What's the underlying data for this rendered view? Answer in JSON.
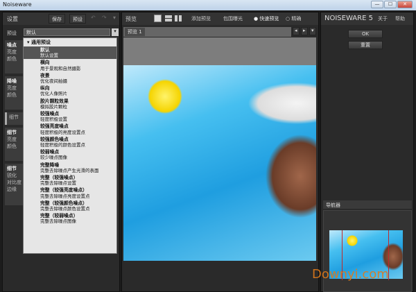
{
  "window": {
    "title": "Noiseware",
    "min": "—",
    "max": "☐",
    "close": "✕"
  },
  "left": {
    "title": "设置",
    "save": "保存",
    "preset": "预设",
    "undo": "↶",
    "redo": "↷",
    "menu": "▾",
    "preset_label": "预设",
    "preset_value": "默认",
    "sections": [
      {
        "title": "噪点",
        "items": [
          "亮度",
          "颜色"
        ]
      },
      {
        "title": "降噪",
        "items": [
          "亮度",
          "颜色"
        ]
      },
      {
        "title": "细节",
        "items": []
      },
      {
        "title": "细节",
        "items": [
          "亮度",
          "颜色"
        ]
      },
      {
        "title": "细节",
        "items": [
          "锐化",
          "对比度",
          "边缘"
        ]
      }
    ]
  },
  "dropdown": {
    "group": "通用预设",
    "items": [
      {
        "name": "默认",
        "desc": "默认设置",
        "selected": true
      },
      {
        "name": "横向",
        "desc": "用于景观和自然摄影"
      },
      {
        "name": "夜景",
        "desc": "优化夜间拍摄"
      },
      {
        "name": "纵向",
        "desc": "优化人像照片"
      },
      {
        "name": "胶片颗粒效果",
        "desc": "模拟胶片颗粒"
      },
      {
        "name": "较强噪点",
        "desc": "轻度积极设置"
      },
      {
        "name": "较强亮度噪点",
        "desc": "轻度积极的亮度设置点"
      },
      {
        "name": "较强颜色噪点",
        "desc": "轻度积极的颜色设置点"
      },
      {
        "name": "较弱噪点",
        "desc": "较少噪点图像"
      },
      {
        "name": "完整降噪",
        "desc": "完整去除噪点产生光滑的表面"
      },
      {
        "name": "完整（较强噪点）",
        "desc": "完整去除噪点设置"
      },
      {
        "name": "完整（较强亮度噪点）",
        "desc": "完整去除噪点亮度设置点"
      },
      {
        "name": "完整（较强颜色噪点）",
        "desc": "完整去除噪点颜色设置点"
      },
      {
        "name": "完整（较弱噪点）",
        "desc": "完整去除噪点图像"
      }
    ]
  },
  "preview": {
    "title": "预览",
    "add": "添加预览",
    "clip": "包围曝光",
    "fast": "快速预览",
    "accurate": "精确",
    "mode": "fast",
    "tab": "预览 1",
    "prev": "◂",
    "next": "▸",
    "more": "▾"
  },
  "right": {
    "brand": "NOISEWARE 5",
    "about": "关于",
    "help": "帮助",
    "ok": "OK",
    "reset": "重置",
    "navigator": "导航器"
  },
  "watermark": "Downyi.com",
  "colors": {
    "watermark": "#e07a1a",
    "nav_frame": "#c0282a",
    "pool": "#29a6e0"
  }
}
